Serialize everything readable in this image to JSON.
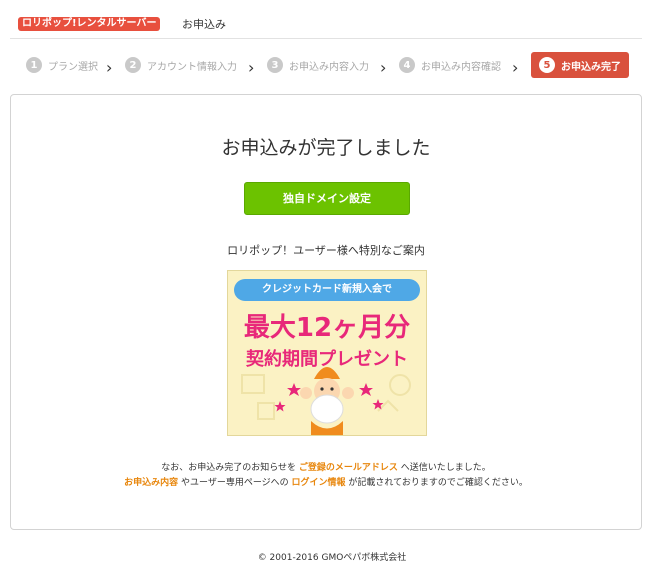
{
  "header": {
    "logo_text": "ロリポップ!レンタルサーバー",
    "title": "お申込み"
  },
  "steps": [
    {
      "num": "1",
      "label": "プラン選択",
      "active": false
    },
    {
      "num": "2",
      "label": "アカウント情報入力",
      "active": false
    },
    {
      "num": "3",
      "label": "お申込み内容入力",
      "active": false
    },
    {
      "num": "4",
      "label": "お申込み内容確認",
      "active": false
    },
    {
      "num": "5",
      "label": "お申込み完了",
      "active": true
    }
  ],
  "main": {
    "title": "お申込みが完了しました",
    "domain_button": "独自ドメイン設定",
    "guide": "ロリポップ！ユーザー様へ特別なご案内"
  },
  "banner": {
    "ribbon": "クレジットカード新規入会で",
    "line1": "最大12ヶ月分",
    "line2": "契約期間プレゼント"
  },
  "notice": {
    "p1_a": "なお、お申込み完了のお知らせを",
    "p1_link": "ご登録のメールアドレス",
    "p1_b": "へ送信いたしました。",
    "p2_link1": "お申込み内容",
    "p2_a": "やユーザー専用ページへの",
    "p2_link2": "ログイン情報",
    "p2_b": "が記載されておりますのでご確認ください。"
  },
  "footer": {
    "copyright": "© 2001-2016 GMOペパボ株式会社"
  }
}
